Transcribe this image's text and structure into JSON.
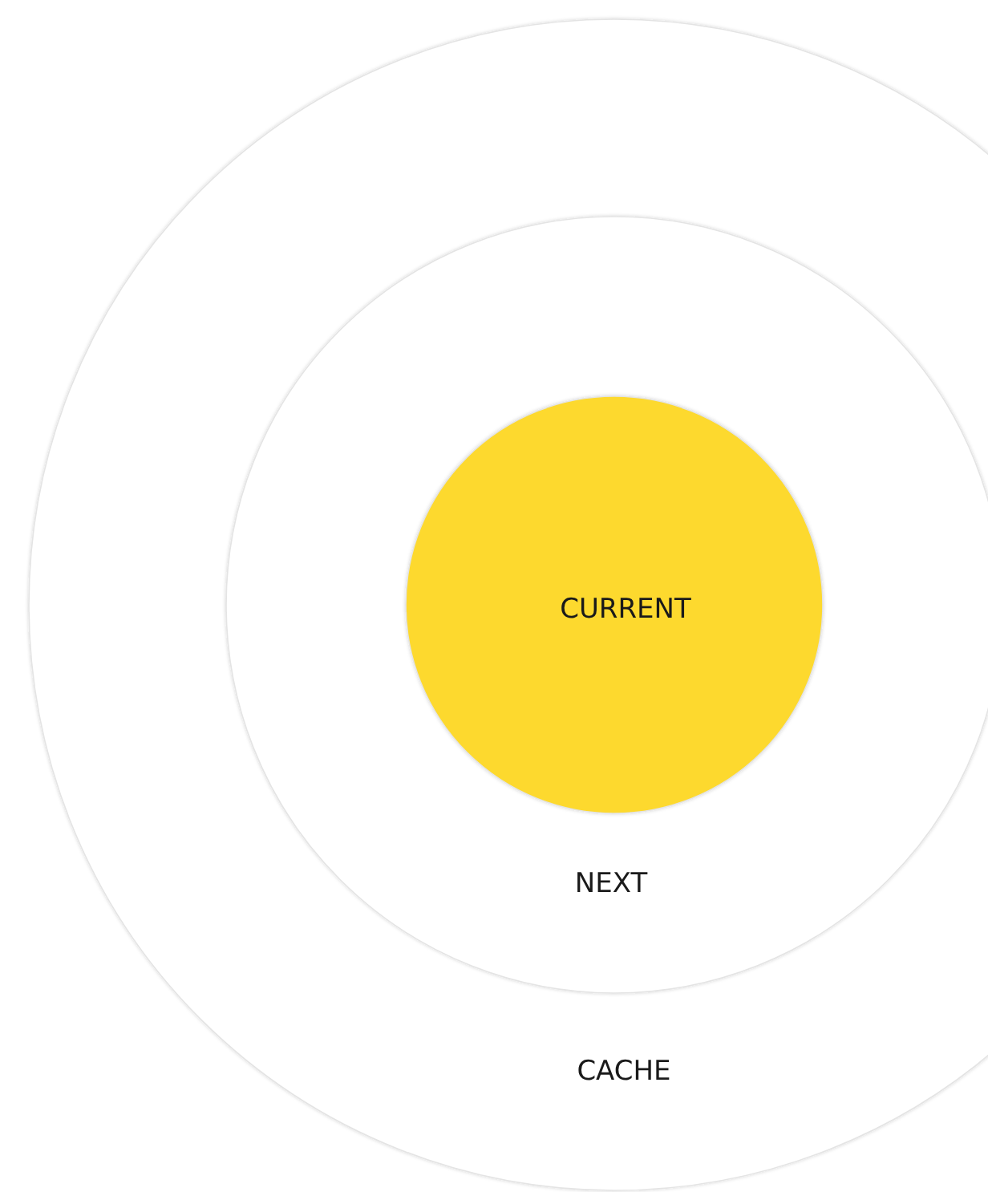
{
  "rings": [
    {
      "label": "CURRENT",
      "kind": "core"
    },
    {
      "label": "NEXT",
      "kind": "middle"
    },
    {
      "label": "CACHE",
      "kind": "outer"
    }
  ]
}
